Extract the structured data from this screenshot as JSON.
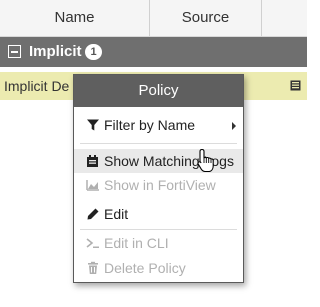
{
  "table": {
    "columns": [
      "Name",
      "Source"
    ]
  },
  "group": {
    "label": "Implicit",
    "count": "1"
  },
  "row": {
    "name": "Implicit De"
  },
  "context_menu": {
    "title": "Policy",
    "items": [
      {
        "label": "Filter by Name",
        "icon": "filter-icon",
        "enabled": true,
        "submenu": true
      },
      {
        "label": "Show Matching Logs",
        "icon": "log-icon",
        "enabled": true,
        "hovered": true
      },
      {
        "label": "Show in FortiView",
        "icon": "chart-icon",
        "enabled": false
      },
      {
        "label": "Edit",
        "icon": "pencil-icon",
        "enabled": true
      },
      {
        "label": "Edit in CLI",
        "icon": "terminal-icon",
        "enabled": false
      },
      {
        "label": "Delete Policy",
        "icon": "trash-icon",
        "enabled": false
      }
    ]
  },
  "colors": {
    "group_bg": "#6f6f6f",
    "row_highlight": "#ecebb0",
    "menu_title_bg": "#5f5f5f",
    "hover_bg": "#e9e9e9",
    "disabled_text": "#b0b0b0"
  }
}
